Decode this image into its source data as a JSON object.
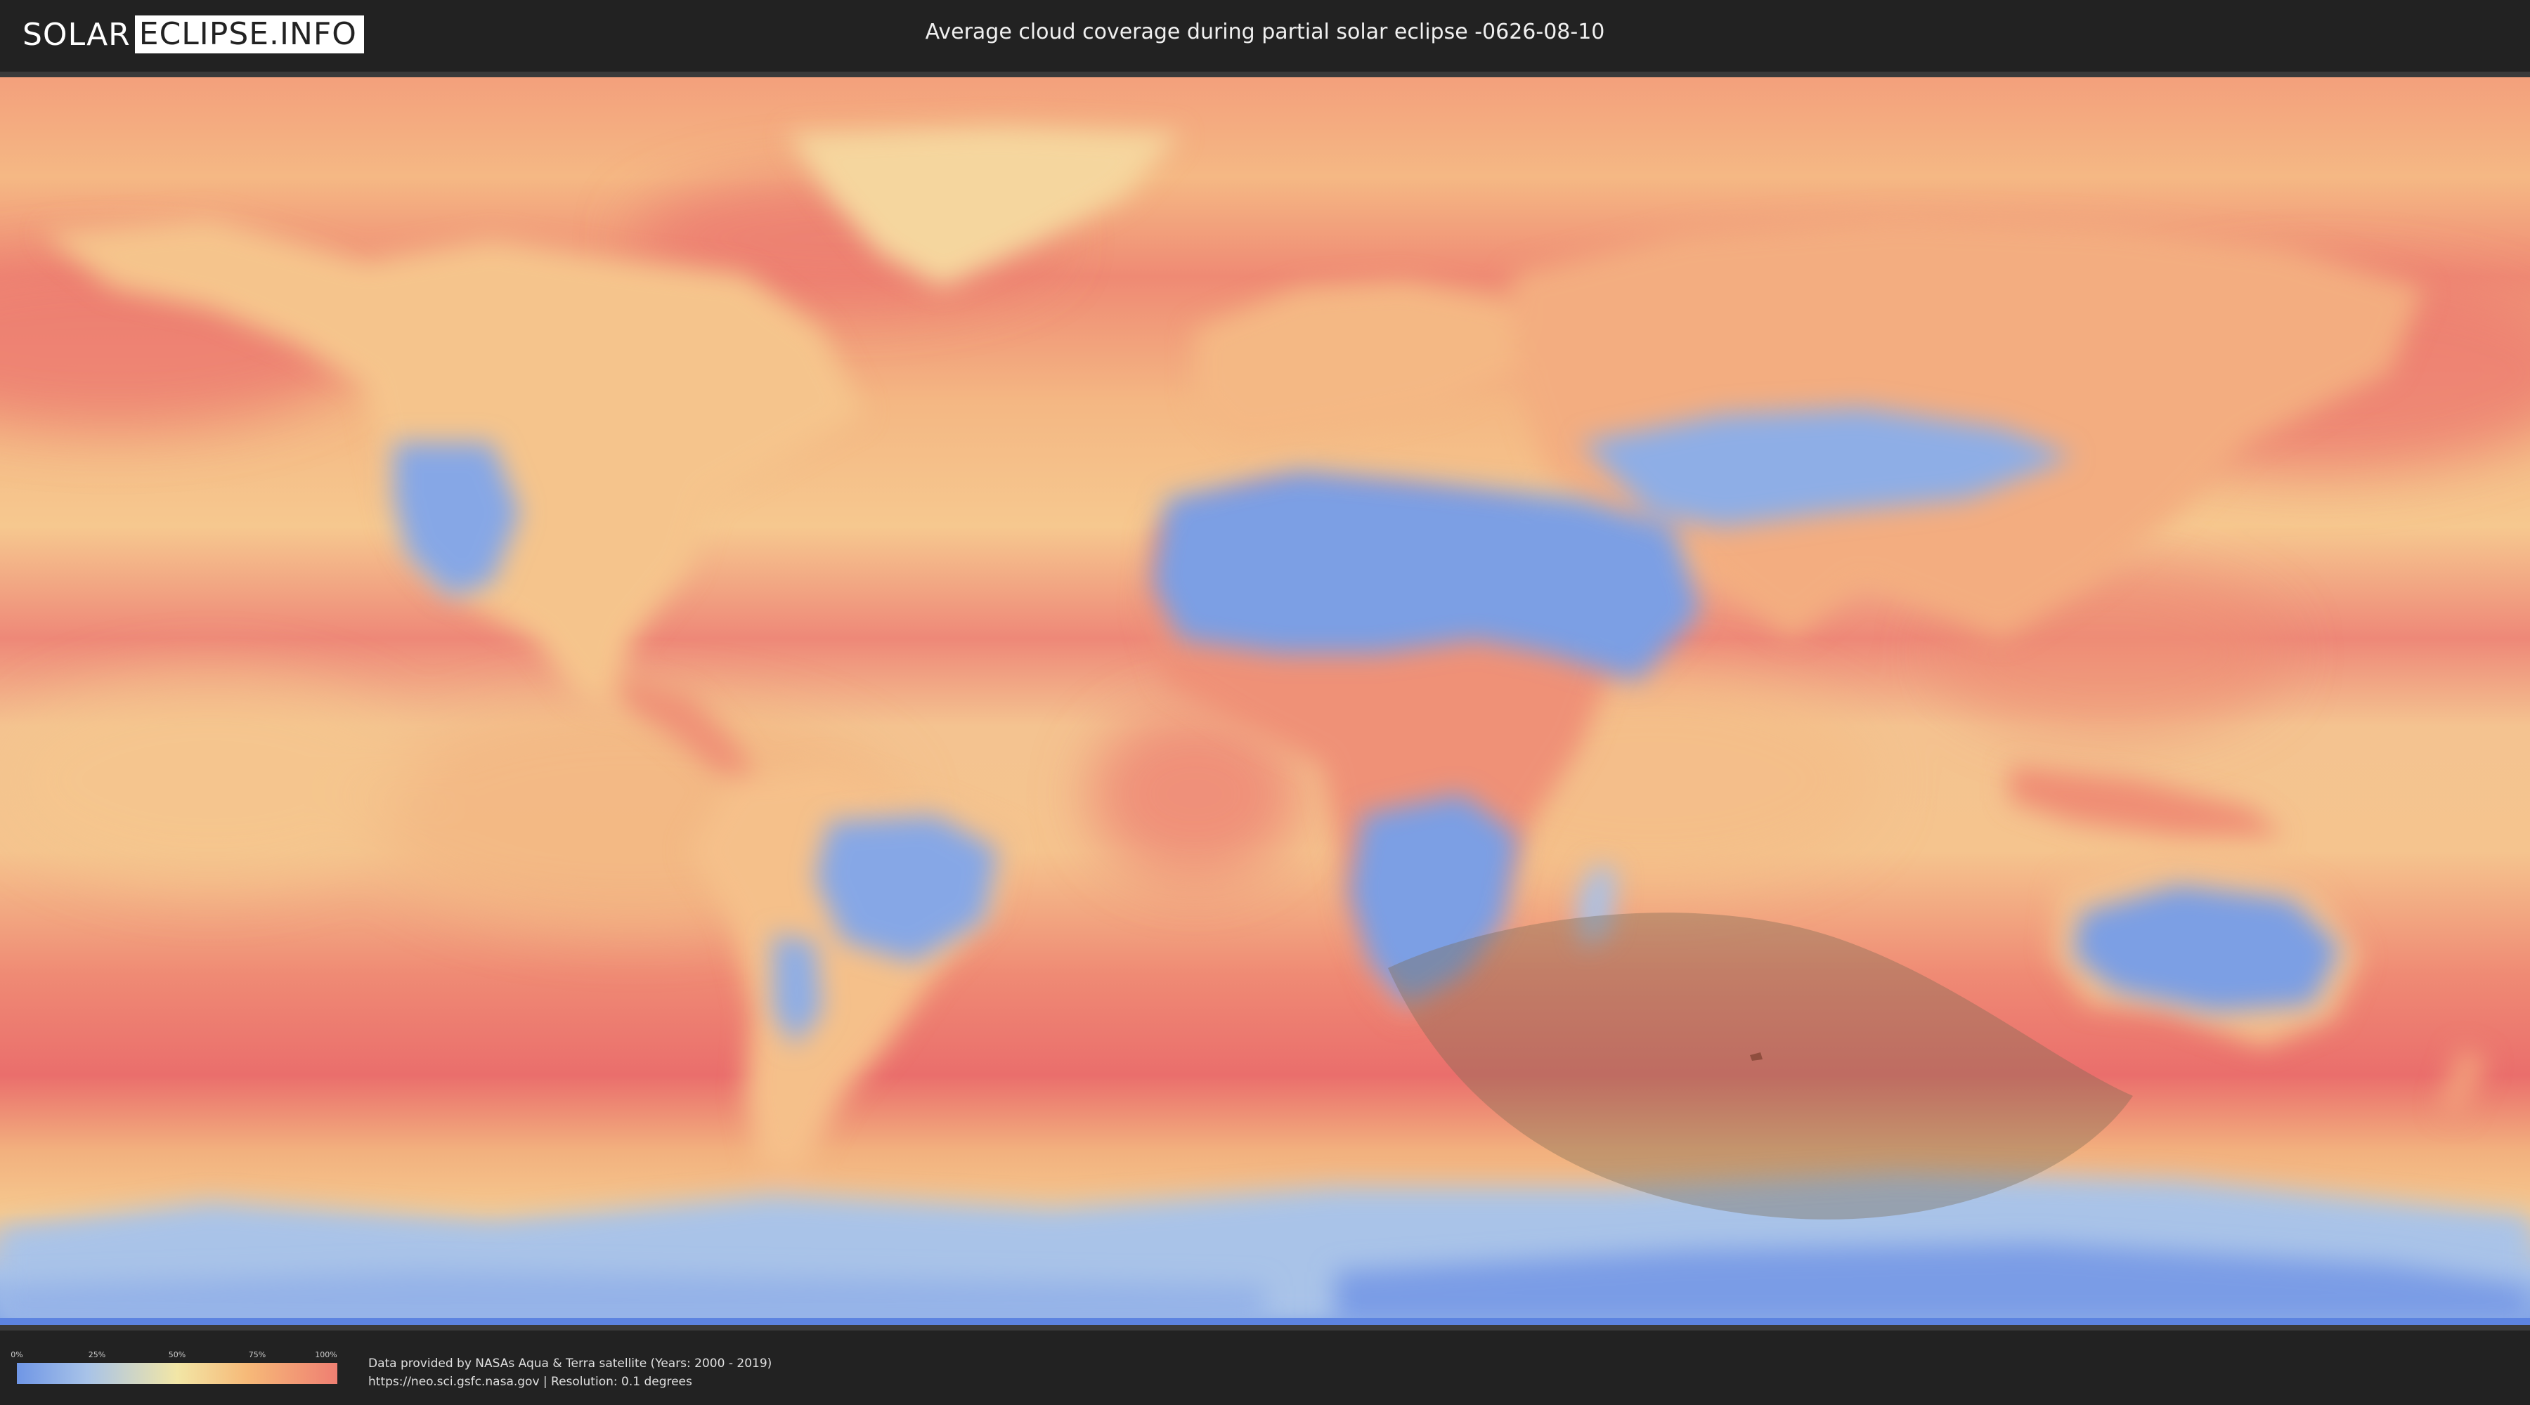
{
  "header": {
    "logo_left": "SOLAR",
    "logo_right": "ECLIPSE.INFO",
    "title": "Average cloud coverage during partial solar eclipse -0626-08-10"
  },
  "map": {
    "colors": {
      "ocean_cloudy": "#ee8374",
      "mid": "#f4c08a",
      "clear": "#8fb0e6",
      "very_clear": "#6f96e6",
      "eclipse_shadow": "#7a6a52"
    },
    "eclipse_zone": "partial eclipse visibility region"
  },
  "legend": {
    "ticks": [
      "0%",
      "25%",
      "50%",
      "75%",
      "100%"
    ],
    "values": [
      0,
      25,
      50,
      75,
      100
    ],
    "unit": "%",
    "colors": [
      "#6f96e6",
      "#a8c3e8",
      "#f2e6a6",
      "#f6b978",
      "#ef7f72"
    ]
  },
  "credits": {
    "line1": "Data provided by NASAs Aqua & Terra satellite (Years: 2000 - 2019)",
    "line2": "https://neo.sci.gsfc.nasa.gov | Resolution: 0.1 degrees"
  }
}
